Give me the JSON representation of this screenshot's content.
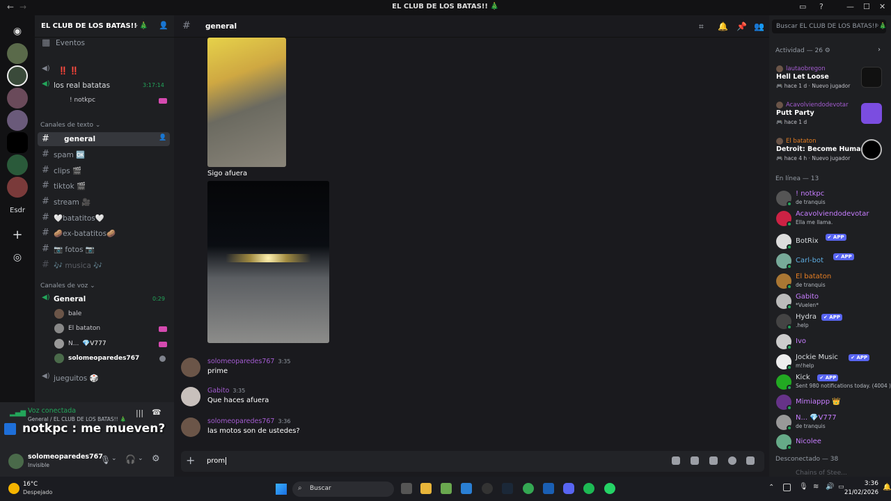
{
  "window": {
    "title": "EL CLUB DE LOS BATAS!! 🎄"
  },
  "guilds": {
    "esdr_label": "Esdr"
  },
  "server": {
    "name": "EL CLUB DE LOS BATAS!! 🎄"
  },
  "channels": {
    "events": "Eventos",
    "top_voice": "‼️ ‼️",
    "real_batatas": {
      "name": "los real batatas",
      "time": "3:17:14"
    },
    "top_user": "! notkpc",
    "text_category": "Canales de texto",
    "text": [
      "general",
      "spam 🆗",
      "clips 🎬",
      "tiktok 🎬",
      "stream 🎥",
      "🤍batatitos🤍",
      "🥔ex-batatitos🥔",
      "📷 fotos 📷",
      "🎶 musica 🎶"
    ],
    "voice_category": "Canales de voz",
    "voice_general": {
      "name": "General",
      "time": "0:29"
    },
    "voice_users": [
      "bale",
      "El bataton",
      "N...",
      "solomeoparedes767"
    ],
    "voice_user_tag": "💎V777",
    "jueguitos": "jueguitos 🎲"
  },
  "voice": {
    "status": "Voz conectada",
    "location": "General / EL CLUB DE LOS BATAS!! 🎄",
    "overlay": "notkpc : me mueven?"
  },
  "user": {
    "name": "solomeoparedes767",
    "status": "Invisible"
  },
  "chat": {
    "channel": "general",
    "caption": "Sigo afuera",
    "messages": [
      {
        "author": "solomeoparedes767",
        "time": "3:35",
        "text": "prime"
      },
      {
        "author": "Gabito",
        "time": "3:35",
        "text": "Que haces afuera"
      },
      {
        "author": "solomeoparedes767",
        "time": "3:36",
        "text": "las motos son de ustedes?"
      }
    ],
    "input_value": "prom"
  },
  "members": {
    "search_placeholder": "Buscar EL CLUB DE LOS BATAS!! 🎄",
    "activity_header": "Actividad — 26 ⚙",
    "activities": [
      {
        "user": "lautaobregon",
        "game": "Hell Let Loose",
        "since": "hace 1 d",
        "tag": "Nuevo jugador"
      },
      {
        "user": "Acavolviendodevotar",
        "game": "Putt Party",
        "since": "hace 1 d",
        "tag": ""
      },
      {
        "user": "El bataton",
        "game": "Detroit: Become Human",
        "since": "hace 4 h",
        "tag": "Nuevo jugador"
      }
    ],
    "online_header": "En línea — 13",
    "online": [
      {
        "name": "! notkpc",
        "status": "de tranquis",
        "color": "#c77dff",
        "app": ""
      },
      {
        "name": "Acavolviendodevotar",
        "status": "Ella me llama.",
        "color": "#c77dff",
        "app": ""
      },
      {
        "name": "BotRix",
        "status": "",
        "color": "#dbdee1",
        "app": "✔ APP"
      },
      {
        "name": "Carl-bot",
        "status": "",
        "color": "#5dade2",
        "app": "✔ APP"
      },
      {
        "name": "El bataton",
        "status": "de tranquis",
        "color": "#e67e22",
        "app": ""
      },
      {
        "name": "Gabito",
        "status": "*Vuelen*",
        "color": "#c77dff",
        "app": ""
      },
      {
        "name": "Hydra",
        "status": ".help",
        "color": "#dbdee1",
        "app": "✔ APP"
      },
      {
        "name": "Ivo",
        "status": "",
        "color": "#c77dff",
        "app": ""
      },
      {
        "name": "Jockie Music",
        "status": "m!help",
        "color": "#dbdee1",
        "app": "✔ APP"
      },
      {
        "name": "Kick",
        "status": "Sent 980 notifications today. (4004 )",
        "color": "#dbdee1",
        "app": "✔ APP"
      },
      {
        "name": "Mimiappp 👑",
        "status": "",
        "color": "#c77dff",
        "app": ""
      },
      {
        "name": "N... 💎V777",
        "status": "de tranquis",
        "color": "#c77dff",
        "app": ""
      },
      {
        "name": "Nicolee",
        "status": "",
        "color": "#c77dff",
        "app": ""
      }
    ],
    "offline_header": "Desconectado — 38",
    "offline_partial": "Chains of Stee..."
  },
  "taskbar": {
    "weather_temp": "16°C",
    "weather_desc": "Despejado",
    "search": "Buscar",
    "time": "3:36",
    "date": "21/02/2026"
  }
}
